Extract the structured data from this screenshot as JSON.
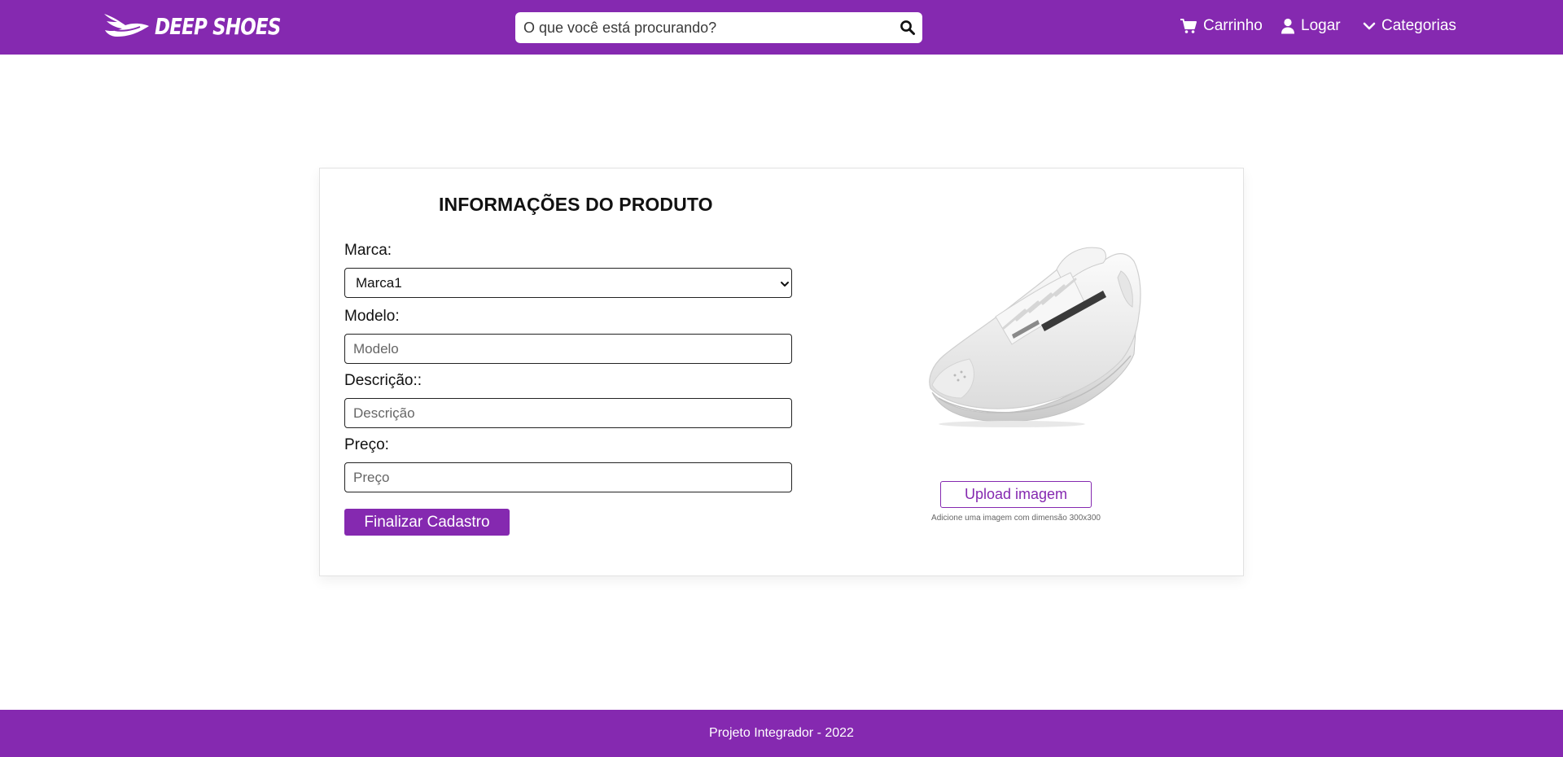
{
  "header": {
    "brand": "DEEP SHOES",
    "search_placeholder": "O que você está procurando?",
    "nav": {
      "cart": "Carrinho",
      "login": "Logar",
      "categories": "Categorias"
    }
  },
  "form": {
    "title": "INFORMAÇÕES DO PRODUTO",
    "brand_label": "Marca:",
    "brand_selected": "Marca1",
    "model_label": "Modelo:",
    "model_placeholder": "Modelo",
    "description_label": "Descrição::",
    "description_placeholder": "Descrição",
    "price_label": "Preço:",
    "price_placeholder": "Preço",
    "submit_label": "Finalizar Cadastro"
  },
  "image_panel": {
    "upload_label": "Upload imagem",
    "hint": "Adicione uma imagem com dimensão 300x300"
  },
  "footer": {
    "text": "Projeto Integrador - 2022"
  },
  "colors": {
    "brand_purple": "#8529b0",
    "background": "#ffffff"
  },
  "icons": {
    "logo": "wing-logo-icon",
    "search": "search-icon",
    "cart": "cart-icon",
    "login": "user-icon",
    "categories": "chevron-down-icon",
    "select": "chevron-down-icon"
  }
}
